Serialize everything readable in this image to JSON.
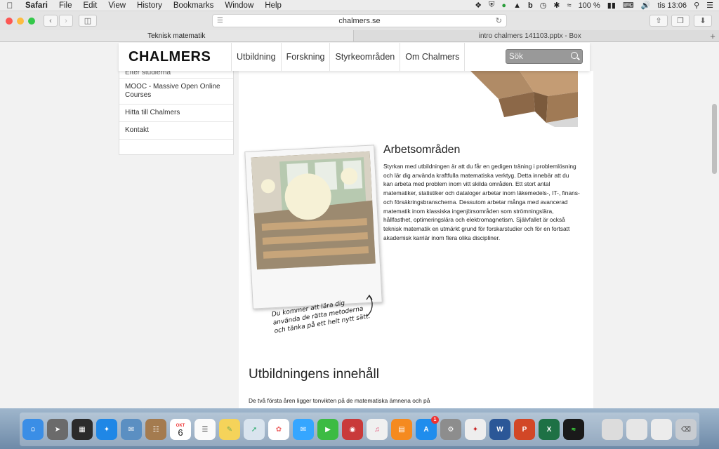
{
  "menubar": {
    "app": "Safari",
    "items": [
      "File",
      "Edit",
      "View",
      "History",
      "Bookmarks",
      "Window",
      "Help"
    ],
    "battery": "100 %",
    "clock": "tis 13:06"
  },
  "browser": {
    "url": "chalmers.se",
    "tabs": [
      {
        "label": "Teknisk matematik",
        "active": true
      },
      {
        "label": "intro chalmers 141103.pptx - Box",
        "active": false
      }
    ]
  },
  "site": {
    "logo": "CHALMERS",
    "nav": [
      "Utbildning",
      "Forskning",
      "Styrkeområden",
      "Om Chalmers"
    ],
    "search_placeholder": "Sök",
    "sidebar": {
      "cut_item": "Efter studierna",
      "items": [
        "MOOC - Massive Open Online Courses",
        "Hitta till Chalmers",
        "Kontakt"
      ]
    },
    "section1": {
      "heading": "Arbetsområden",
      "body": "Styrkan med utbildningen är att du får en gedigen träning i problemlösning och lär dig använda kraftfulla matematiska verktyg. Detta innebär att du kan arbeta med problem inom vitt skilda områden. Ett stort antal matematiker, statistiker och dataloger arbetar inom läkemedels-, IT-, finans- och försäkringsbranscherna. Dessutom arbetar många med avancerad matematik inom klassiska ingenjörsområden som strömningslära, hållfasthet, optimeringslära och elektromagnetism. Självfallet är också teknisk matematik en utmärkt grund för forskarstudier och för en fortsatt akademisk karriär inom flera olika discipliner."
    },
    "caption": [
      "Du kommer att lära dig",
      "använda de rätta metoderna",
      "och tänka på ett helt nytt sätt."
    ],
    "section2": {
      "heading": "Utbildningens innehåll",
      "body": "De två första åren ligger tonvikten på de matematiska ämnena och på"
    }
  },
  "dock": {
    "calendar_month": "OKT",
    "calendar_day": "6"
  }
}
